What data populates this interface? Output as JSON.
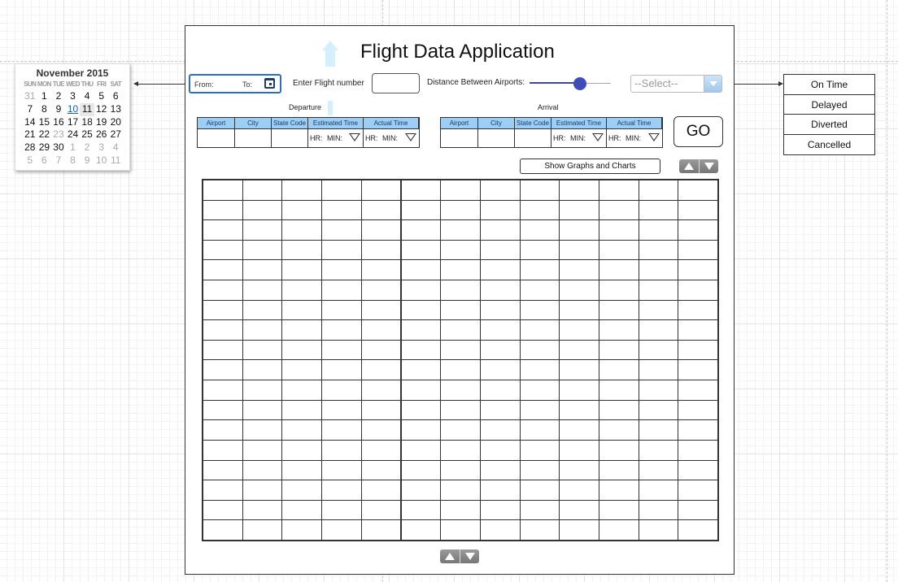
{
  "app": {
    "title": "Flight Data Application"
  },
  "calendar": {
    "month_label": "November 2015",
    "day_headers": [
      "SUN",
      "MON",
      "TUE",
      "WED",
      "THU",
      "FRI",
      "SAT"
    ],
    "weeks": [
      [
        "31",
        "1",
        "2",
        "3",
        "4",
        "5",
        "6"
      ],
      [
        "7",
        "8",
        "9",
        "10",
        "11",
        "12",
        "13"
      ],
      [
        "14",
        "15",
        "16",
        "17",
        "18",
        "19",
        "20"
      ],
      [
        "21",
        "22",
        "23",
        "24",
        "25",
        "26",
        "27"
      ],
      [
        "28",
        "29",
        "30",
        "1",
        "2",
        "3",
        "4"
      ],
      [
        "5",
        "6",
        "7",
        "8",
        "9",
        "10",
        "11"
      ]
    ]
  },
  "date_range": {
    "from_label": "From:",
    "to_label": "To:"
  },
  "flight_number": {
    "label": "Enter Flight number",
    "value": ""
  },
  "distance": {
    "label": "Distance Between Airports:"
  },
  "airline_select": {
    "value": "--Select--"
  },
  "status_options": [
    "On Time",
    "Delayed",
    "Diverted",
    "Cancelled"
  ],
  "departure": {
    "title": "Departure",
    "columns": [
      "Airport",
      "City",
      "State Code",
      "Estimated Time",
      "Actual Time"
    ],
    "hr_label": "HR:",
    "min_label": "MIN:"
  },
  "arrival": {
    "title": "Arrival",
    "columns": [
      "Airport",
      "City",
      "State Code",
      "Estimated Time",
      "Actual Time"
    ],
    "hr_label": "HR:",
    "min_label": "MIN:"
  },
  "go_button": {
    "label": "GO"
  },
  "graphs_button": {
    "label": "Show Graphs and Charts"
  },
  "results_grid": {
    "rows": 18,
    "columns": 13
  },
  "colors": {
    "accent": "#2e6fb8",
    "header_fill": "#9ccff7",
    "slider": "#3f4db8"
  }
}
